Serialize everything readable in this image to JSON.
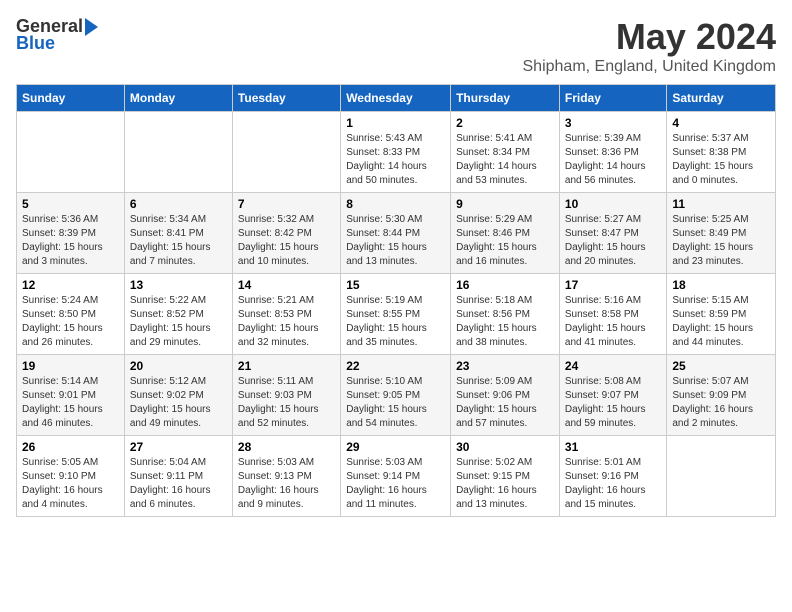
{
  "header": {
    "logo_general": "General",
    "logo_blue": "Blue",
    "title": "May 2024",
    "subtitle": "Shipham, England, United Kingdom"
  },
  "weekdays": [
    "Sunday",
    "Monday",
    "Tuesday",
    "Wednesday",
    "Thursday",
    "Friday",
    "Saturday"
  ],
  "weeks": [
    [
      {
        "day": "",
        "info": ""
      },
      {
        "day": "",
        "info": ""
      },
      {
        "day": "",
        "info": ""
      },
      {
        "day": "1",
        "info": "Sunrise: 5:43 AM\nSunset: 8:33 PM\nDaylight: 14 hours\nand 50 minutes."
      },
      {
        "day": "2",
        "info": "Sunrise: 5:41 AM\nSunset: 8:34 PM\nDaylight: 14 hours\nand 53 minutes."
      },
      {
        "day": "3",
        "info": "Sunrise: 5:39 AM\nSunset: 8:36 PM\nDaylight: 14 hours\nand 56 minutes."
      },
      {
        "day": "4",
        "info": "Sunrise: 5:37 AM\nSunset: 8:38 PM\nDaylight: 15 hours\nand 0 minutes."
      }
    ],
    [
      {
        "day": "5",
        "info": "Sunrise: 5:36 AM\nSunset: 8:39 PM\nDaylight: 15 hours\nand 3 minutes."
      },
      {
        "day": "6",
        "info": "Sunrise: 5:34 AM\nSunset: 8:41 PM\nDaylight: 15 hours\nand 7 minutes."
      },
      {
        "day": "7",
        "info": "Sunrise: 5:32 AM\nSunset: 8:42 PM\nDaylight: 15 hours\nand 10 minutes."
      },
      {
        "day": "8",
        "info": "Sunrise: 5:30 AM\nSunset: 8:44 PM\nDaylight: 15 hours\nand 13 minutes."
      },
      {
        "day": "9",
        "info": "Sunrise: 5:29 AM\nSunset: 8:46 PM\nDaylight: 15 hours\nand 16 minutes."
      },
      {
        "day": "10",
        "info": "Sunrise: 5:27 AM\nSunset: 8:47 PM\nDaylight: 15 hours\nand 20 minutes."
      },
      {
        "day": "11",
        "info": "Sunrise: 5:25 AM\nSunset: 8:49 PM\nDaylight: 15 hours\nand 23 minutes."
      }
    ],
    [
      {
        "day": "12",
        "info": "Sunrise: 5:24 AM\nSunset: 8:50 PM\nDaylight: 15 hours\nand 26 minutes."
      },
      {
        "day": "13",
        "info": "Sunrise: 5:22 AM\nSunset: 8:52 PM\nDaylight: 15 hours\nand 29 minutes."
      },
      {
        "day": "14",
        "info": "Sunrise: 5:21 AM\nSunset: 8:53 PM\nDaylight: 15 hours\nand 32 minutes."
      },
      {
        "day": "15",
        "info": "Sunrise: 5:19 AM\nSunset: 8:55 PM\nDaylight: 15 hours\nand 35 minutes."
      },
      {
        "day": "16",
        "info": "Sunrise: 5:18 AM\nSunset: 8:56 PM\nDaylight: 15 hours\nand 38 minutes."
      },
      {
        "day": "17",
        "info": "Sunrise: 5:16 AM\nSunset: 8:58 PM\nDaylight: 15 hours\nand 41 minutes."
      },
      {
        "day": "18",
        "info": "Sunrise: 5:15 AM\nSunset: 8:59 PM\nDaylight: 15 hours\nand 44 minutes."
      }
    ],
    [
      {
        "day": "19",
        "info": "Sunrise: 5:14 AM\nSunset: 9:01 PM\nDaylight: 15 hours\nand 46 minutes."
      },
      {
        "day": "20",
        "info": "Sunrise: 5:12 AM\nSunset: 9:02 PM\nDaylight: 15 hours\nand 49 minutes."
      },
      {
        "day": "21",
        "info": "Sunrise: 5:11 AM\nSunset: 9:03 PM\nDaylight: 15 hours\nand 52 minutes."
      },
      {
        "day": "22",
        "info": "Sunrise: 5:10 AM\nSunset: 9:05 PM\nDaylight: 15 hours\nand 54 minutes."
      },
      {
        "day": "23",
        "info": "Sunrise: 5:09 AM\nSunset: 9:06 PM\nDaylight: 15 hours\nand 57 minutes."
      },
      {
        "day": "24",
        "info": "Sunrise: 5:08 AM\nSunset: 9:07 PM\nDaylight: 15 hours\nand 59 minutes."
      },
      {
        "day": "25",
        "info": "Sunrise: 5:07 AM\nSunset: 9:09 PM\nDaylight: 16 hours\nand 2 minutes."
      }
    ],
    [
      {
        "day": "26",
        "info": "Sunrise: 5:05 AM\nSunset: 9:10 PM\nDaylight: 16 hours\nand 4 minutes."
      },
      {
        "day": "27",
        "info": "Sunrise: 5:04 AM\nSunset: 9:11 PM\nDaylight: 16 hours\nand 6 minutes."
      },
      {
        "day": "28",
        "info": "Sunrise: 5:03 AM\nSunset: 9:13 PM\nDaylight: 16 hours\nand 9 minutes."
      },
      {
        "day": "29",
        "info": "Sunrise: 5:03 AM\nSunset: 9:14 PM\nDaylight: 16 hours\nand 11 minutes."
      },
      {
        "day": "30",
        "info": "Sunrise: 5:02 AM\nSunset: 9:15 PM\nDaylight: 16 hours\nand 13 minutes."
      },
      {
        "day": "31",
        "info": "Sunrise: 5:01 AM\nSunset: 9:16 PM\nDaylight: 16 hours\nand 15 minutes."
      },
      {
        "day": "",
        "info": ""
      }
    ]
  ]
}
